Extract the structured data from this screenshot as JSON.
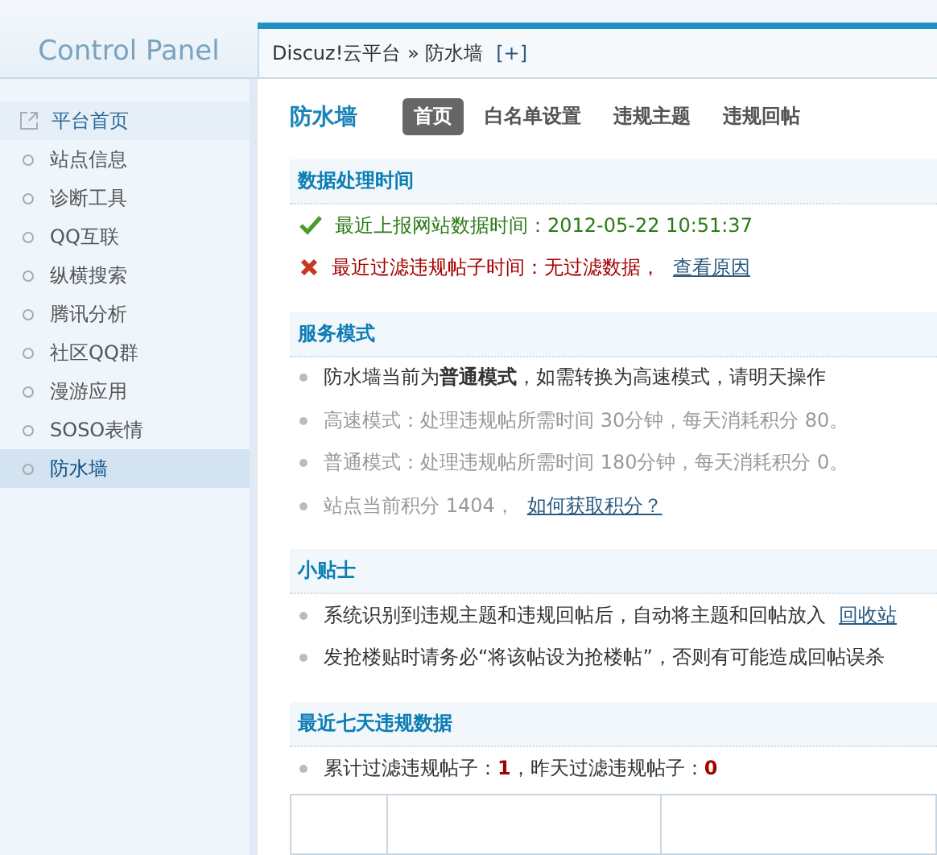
{
  "header": {
    "subtitle": "Control Panel"
  },
  "breadcrumb": {
    "path": "Discuz!云平台 » 防水墙",
    "add": "[+]"
  },
  "sidebar": {
    "items": [
      {
        "label": "平台首页",
        "kind": "external",
        "selected": false
      },
      {
        "label": "站点信息",
        "kind": "bullet",
        "selected": false
      },
      {
        "label": "诊断工具",
        "kind": "bullet",
        "selected": false
      },
      {
        "label": "QQ互联",
        "kind": "bullet",
        "selected": false
      },
      {
        "label": "纵横搜索",
        "kind": "bullet",
        "selected": false
      },
      {
        "label": "腾讯分析",
        "kind": "bullet",
        "selected": false
      },
      {
        "label": "社区QQ群",
        "kind": "bullet",
        "selected": false
      },
      {
        "label": "漫游应用",
        "kind": "bullet",
        "selected": false
      },
      {
        "label": "SOSO表情",
        "kind": "bullet",
        "selected": false
      },
      {
        "label": "防水墙",
        "kind": "bullet",
        "selected": true
      }
    ]
  },
  "page": {
    "title": "防水墙",
    "tabs": [
      {
        "label": "首页",
        "selected": true
      },
      {
        "label": "白名单设置",
        "selected": false
      },
      {
        "label": "违规主题",
        "selected": false
      },
      {
        "label": "违规回帖",
        "selected": false
      }
    ]
  },
  "sections": [
    {
      "title": "数据处理时间",
      "items": [
        {
          "kind": "ok",
          "text": "最近上报网站数据时间：2012-05-22 10:51:37"
        },
        {
          "kind": "error",
          "text": "最近过滤违规帖子时间：无过滤数据，",
          "link": "查看原因"
        }
      ]
    },
    {
      "title": "服务模式",
      "items": [
        {
          "kind": "bullet",
          "muted": false,
          "text": "防水墙当前为**普通模式**，如需转换为高速模式，请明天操作"
        },
        {
          "kind": "bullet",
          "muted": true,
          "text": "高速模式：处理违规帖所需时间 30分钟，每天消耗积分 80。"
        },
        {
          "kind": "bullet",
          "muted": true,
          "text": "普通模式：处理违规帖所需时间 180分钟，每天消耗积分 0。"
        },
        {
          "kind": "bullet",
          "muted": true,
          "text": "站点当前积分 1404，",
          "link": "如何获取积分？"
        }
      ]
    },
    {
      "title": "小贴士",
      "items": [
        {
          "kind": "bullet",
          "muted": false,
          "text": "系统识别到违规主题和违规回帖后，自动将主题和回帖放入 ",
          "link": "回收站"
        },
        {
          "kind": "bullet",
          "muted": false,
          "text": "发抢楼贴时请务必“将该帖设为抢楼帖”，否则有可能造成回帖误杀"
        }
      ]
    },
    {
      "title": "最近七天违规数据",
      "items": [
        {
          "kind": "stat",
          "muted": false,
          "text": "累计过滤违规帖子：**1**，昨天过滤违规帖子：**0**"
        }
      ]
    }
  ]
}
